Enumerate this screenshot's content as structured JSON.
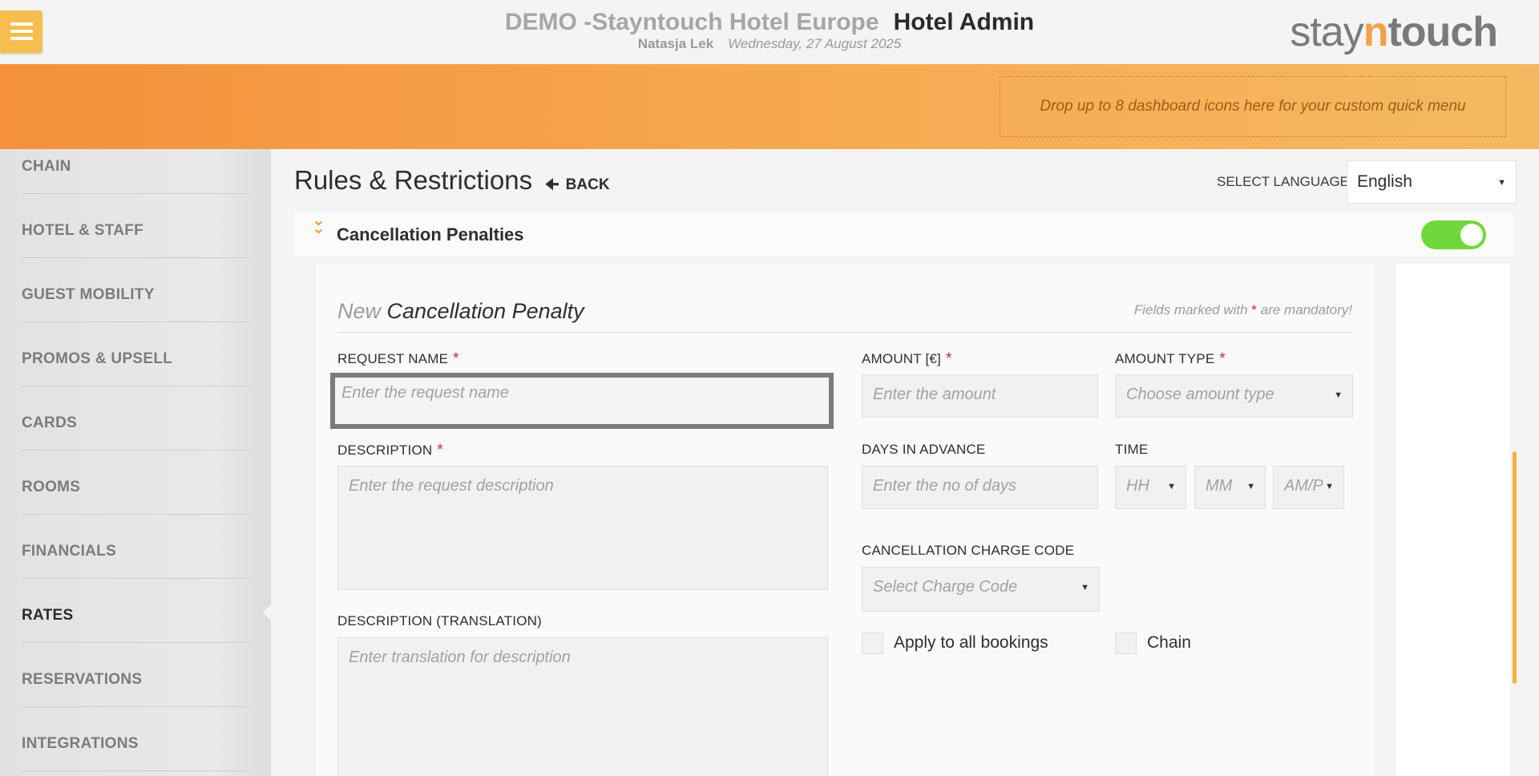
{
  "header": {
    "title_demo": "DEMO -Stayntouch Hotel Europe",
    "title_admin": "Hotel Admin",
    "user": "Natasja Lek",
    "date": "Wednesday, 27 August 2025",
    "logo_a": "stay",
    "logo_b": "n",
    "logo_c": "touch"
  },
  "quick_menu_hint": "Drop up to 8 dashboard icons here for your custom quick menu",
  "sidebar": {
    "items": [
      {
        "label": "CHAIN"
      },
      {
        "label": "HOTEL & STAFF"
      },
      {
        "label": "GUEST MOBILITY"
      },
      {
        "label": "PROMOS & UPSELL"
      },
      {
        "label": "CARDS"
      },
      {
        "label": "ROOMS"
      },
      {
        "label": "FINANCIALS"
      },
      {
        "label": "RATES"
      },
      {
        "label": "RESERVATIONS"
      },
      {
        "label": "INTEGRATIONS"
      }
    ],
    "active": "RATES"
  },
  "page": {
    "title": "Rules & Restrictions",
    "back_label": "BACK",
    "language_label": "SELECT LANGUAGE",
    "language_value": "English"
  },
  "section": {
    "title": "Cancellation Penalties",
    "enabled": true
  },
  "form": {
    "heading_new": "New",
    "heading_rest": "Cancellation Penalty",
    "mandatory_note_a": "Fields marked with",
    "mandatory_star": "*",
    "mandatory_note_b": "are mandatory!",
    "request_name_label": "REQUEST NAME",
    "request_name_placeholder": "Enter the request name",
    "description_label": "DESCRIPTION",
    "description_placeholder": "Enter the request description",
    "description_translation_label": "DESCRIPTION (TRANSLATION)",
    "description_translation_placeholder": "Enter translation for description",
    "amount_label": "AMOUNT [€]",
    "amount_placeholder": "Enter the amount",
    "amount_type_label": "AMOUNT TYPE",
    "amount_type_placeholder": "Choose amount type",
    "days_label": "DAYS IN ADVANCE",
    "days_placeholder": "Enter the no of days",
    "time_label": "TIME",
    "time_hh": "HH",
    "time_mm": "MM",
    "time_ampm": "AM/P",
    "charge_code_label": "CANCELLATION CHARGE CODE",
    "charge_code_placeholder": "Select Charge Code",
    "apply_all_label": "Apply to all bookings",
    "chain_label": "Chain"
  },
  "colors": {
    "accent_orange": "#f4913a",
    "toggle_green": "#6fd93c",
    "required_red": "#d2232a"
  }
}
